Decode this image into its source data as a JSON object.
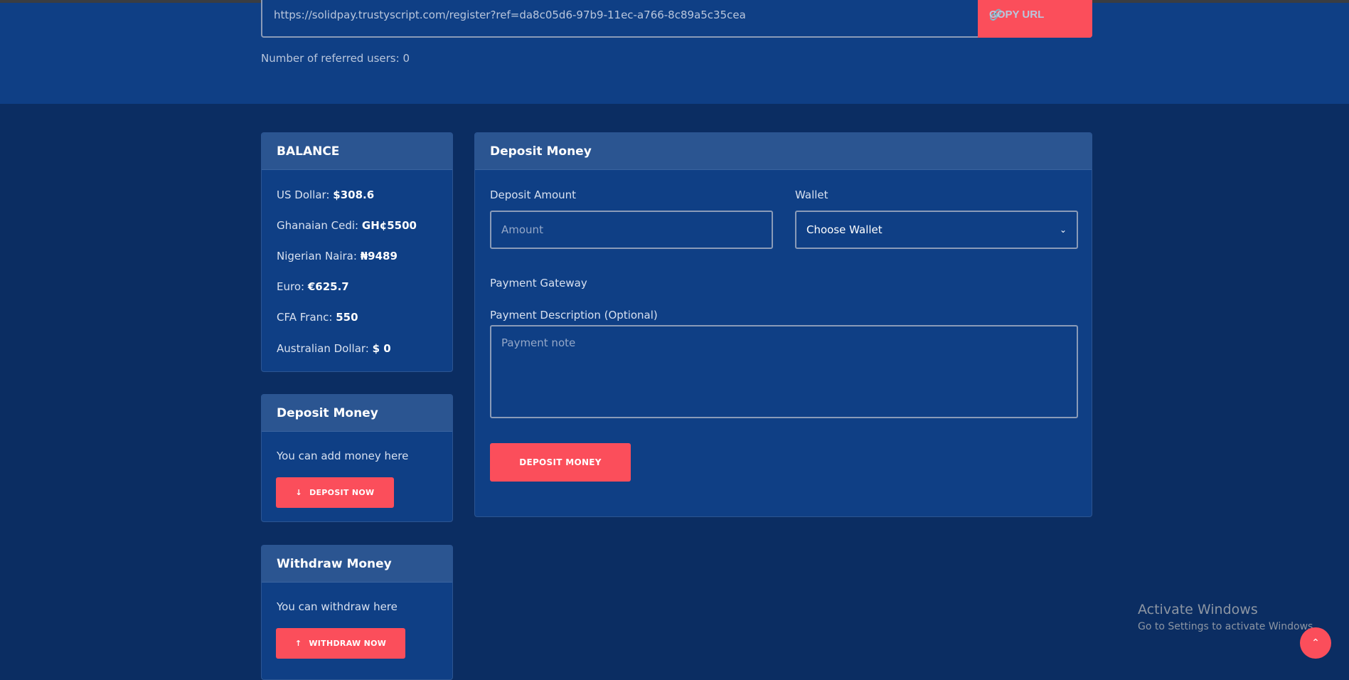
{
  "referral": {
    "url": "https://solidpay.trustyscript.com/register?ref=da8c05d6-97b9-11ec-a766-8c89a5c35cea",
    "copy_label": "COPY URL",
    "referred_text": "Number of referred users: 0"
  },
  "balance": {
    "title": "BALANCE",
    "items": [
      {
        "label": "US Dollar:",
        "value": "$308.6"
      },
      {
        "label": "Ghanaian Cedi:",
        "value": "GH¢5500"
      },
      {
        "label": "Nigerian Naira:",
        "value": "₦9489"
      },
      {
        "label": "Euro:",
        "value": "€625.7"
      },
      {
        "label": "CFA Franc:",
        "value": "550"
      },
      {
        "label": "Australian Dollar:",
        "value": "$ 0"
      }
    ]
  },
  "deposit_card": {
    "title": "Deposit Money",
    "text": "You can add money here",
    "button": "DEPOSIT NOW"
  },
  "withdraw_card": {
    "title": "Withdraw Money",
    "text": "You can withdraw here",
    "button": "WITHDRAW NOW"
  },
  "deposit_form": {
    "title": "Deposit Money",
    "amount_label": "Deposit Amount",
    "amount_placeholder": "Amount",
    "wallet_label": "Wallet",
    "wallet_selected": "Choose Wallet",
    "gateway_label": "Payment Gateway",
    "description_label": "Payment Description (Optional)",
    "description_placeholder": "Payment note",
    "submit": "DEPOSIT MONEY"
  },
  "windows": {
    "title": "Activate Windows",
    "subtitle": "Go to Settings to activate Windows."
  },
  "colors": {
    "accent": "#fb4e5b",
    "band": "#0f3f85",
    "background": "#0b2d62"
  }
}
